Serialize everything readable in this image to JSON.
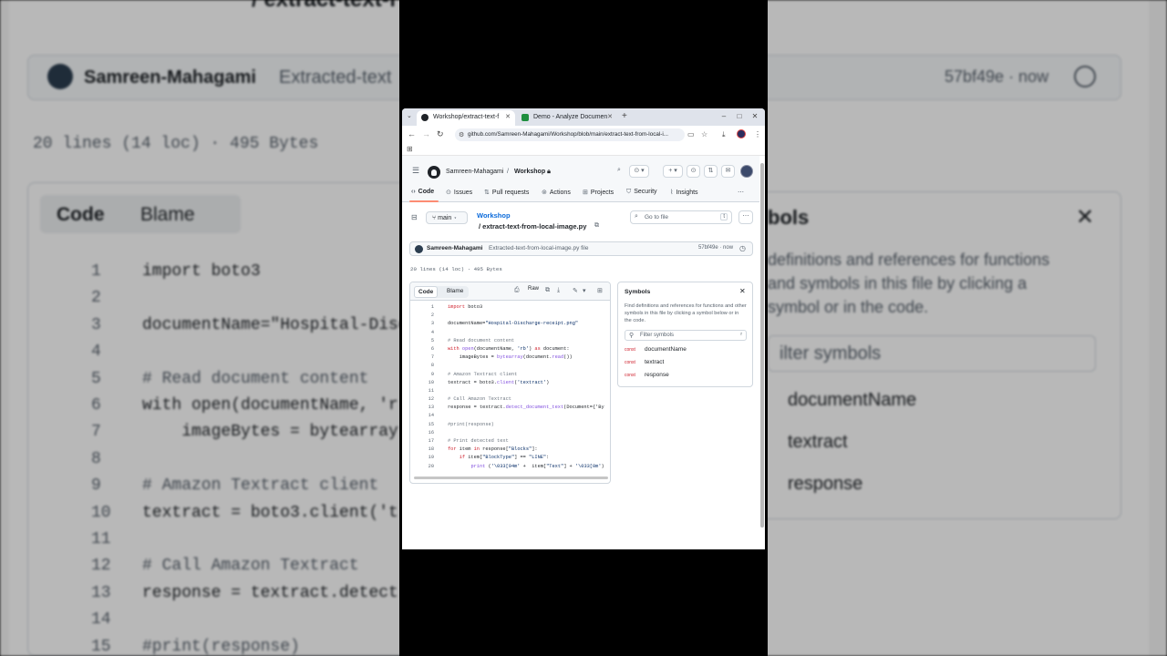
{
  "background": {
    "path_fragment": "/ extract-text-f",
    "commit_author": "Samreen-Mahagami",
    "commit_msg": "Extracted-text",
    "commit_sha": "57bf49e · now",
    "lines_info": "20 lines (14 loc) · 495 Bytes",
    "tab_code": "Code",
    "tab_blame": "Blame",
    "symbols_title": "bols",
    "symbols_desc": "definitions and references for functions and symbols in this file by clicking a symbol or in the code.",
    "filter_placeholder": "ilter symbols",
    "symbols": [
      "documentName",
      "textract",
      "response"
    ],
    "code_lines": [
      {
        "n": "1",
        "t": "import boto3"
      },
      {
        "n": "2",
        "t": ""
      },
      {
        "n": "3",
        "t": "documentName=\"Hospital-Disc"
      },
      {
        "n": "4",
        "t": ""
      },
      {
        "n": "5",
        "t": "# Read document content"
      },
      {
        "n": "6",
        "t": "with open(documentName, 'r"
      },
      {
        "n": "7",
        "t": "    imageBytes = bytearray"
      },
      {
        "n": "8",
        "t": ""
      },
      {
        "n": "9",
        "t": "# Amazon Textract client"
      },
      {
        "n": "10",
        "t": "textract = boto3.client('t"
      },
      {
        "n": "11",
        "t": ""
      },
      {
        "n": "12",
        "t": "# Call Amazon Textract"
      },
      {
        "n": "13",
        "t": "response = textract.detect"
      },
      {
        "n": "14",
        "t": ""
      },
      {
        "n": "15",
        "t": "#print(response)"
      }
    ]
  },
  "browser": {
    "tabs": [
      {
        "label": "Workshop/extract-text-f",
        "active": true
      },
      {
        "label": "Demo - Analyze Documen",
        "active": false
      }
    ],
    "url": "github.com/Samreen-Mahagami/Workshop/blob/main/extract-text-from-local-i..."
  },
  "github": {
    "owner": "Samreen-Mahagami",
    "separator": "/",
    "repo": "Workshop",
    "nav": [
      "Code",
      "Issues",
      "Pull requests",
      "Actions",
      "Projects",
      "Security",
      "Insights"
    ],
    "branch": "main",
    "repo_link": "Workshop",
    "file_path": "/ extract-text-from-local-image.py",
    "goto_placeholder": "Go to file",
    "goto_key": "t",
    "commit_author": "Samreen-Mahagami",
    "commit_msg": "Extracted-text-from-local-image.py file",
    "commit_sha": "57bf49e · now",
    "lines_info": "20 lines (14 loc) · 495 Bytes",
    "code_tab": "Code",
    "blame_tab": "Blame",
    "raw_label": "Raw",
    "code_lines": [
      {
        "n": "1",
        "t": "import boto3"
      },
      {
        "n": "2",
        "t": ""
      },
      {
        "n": "3",
        "t": "documentName=\"Hospital-Discharge-receipt.png\""
      },
      {
        "n": "4",
        "t": ""
      },
      {
        "n": "5",
        "t": "# Read document content"
      },
      {
        "n": "6",
        "t": "with open(documentName, 'rb') as document:"
      },
      {
        "n": "7",
        "t": "    imageBytes = bytearray(document.read())"
      },
      {
        "n": "8",
        "t": ""
      },
      {
        "n": "9",
        "t": "# Amazon Textract client"
      },
      {
        "n": "10",
        "t": "textract = boto3.client('textract')"
      },
      {
        "n": "11",
        "t": ""
      },
      {
        "n": "12",
        "t": "# Call Amazon Textract"
      },
      {
        "n": "13",
        "t": "response = textract.detect_document_text(Document={'By"
      },
      {
        "n": "14",
        "t": ""
      },
      {
        "n": "15",
        "t": "#print(response)"
      },
      {
        "n": "16",
        "t": ""
      },
      {
        "n": "17",
        "t": "# Print detected text"
      },
      {
        "n": "18",
        "t": "for item in response[\"Blocks\"]:"
      },
      {
        "n": "19",
        "t": "    if item[\"BlockType\"] == \"LINE\":"
      },
      {
        "n": "20",
        "t": "        print ('\\033[94m' +  item[\"Text\"] + '\\033[0m')"
      }
    ],
    "symbols_title": "Symbols",
    "symbols_desc": "Find definitions and references for functions and other symbols in this file by clicking a symbol below or in the code.",
    "filter_placeholder": "Filter symbols",
    "filter_key": "r",
    "symbol_badge": "const",
    "symbols": [
      "documentName",
      "textract",
      "response"
    ]
  }
}
